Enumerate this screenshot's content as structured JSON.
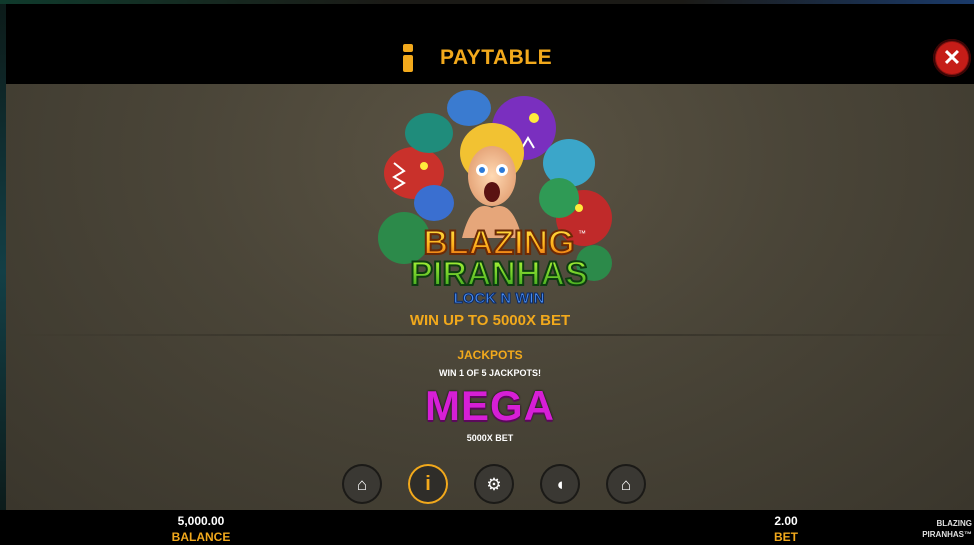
{
  "header": {
    "title": "PAYTABLE",
    "info_icon": "info-icon",
    "close_icon": "close-icon",
    "accent_color": "#f2a91c"
  },
  "logo": {
    "line1": "BLAZING",
    "line2": "PIRANHAS",
    "line3": "LOCK N WIN",
    "tm": "™"
  },
  "promo": "WIN UP TO 5000X BET",
  "jackpots": {
    "title": "JACKPOTS",
    "subtitle": "WIN 1 OF 5 JACKPOTS!",
    "tier": "MEGA",
    "tier_value": "5000X BET",
    "tier_color": "#d61fd6"
  },
  "nav": [
    {
      "icon": "home-icon",
      "glyph": "⌂"
    },
    {
      "icon": "info-icon",
      "glyph": "i"
    },
    {
      "icon": "gear-icon",
      "glyph": "⚙"
    },
    {
      "icon": "shield-icon",
      "glyph": "◖"
    },
    {
      "icon": "bank-icon",
      "glyph": "⌂"
    }
  ],
  "footer": {
    "balance_value": "5,000.00",
    "balance_label": "BALANCE",
    "bet_value": "2.00",
    "bet_label": "BET",
    "brand_line1": "BLAZING",
    "brand_line2": "PIRANHAS™"
  }
}
